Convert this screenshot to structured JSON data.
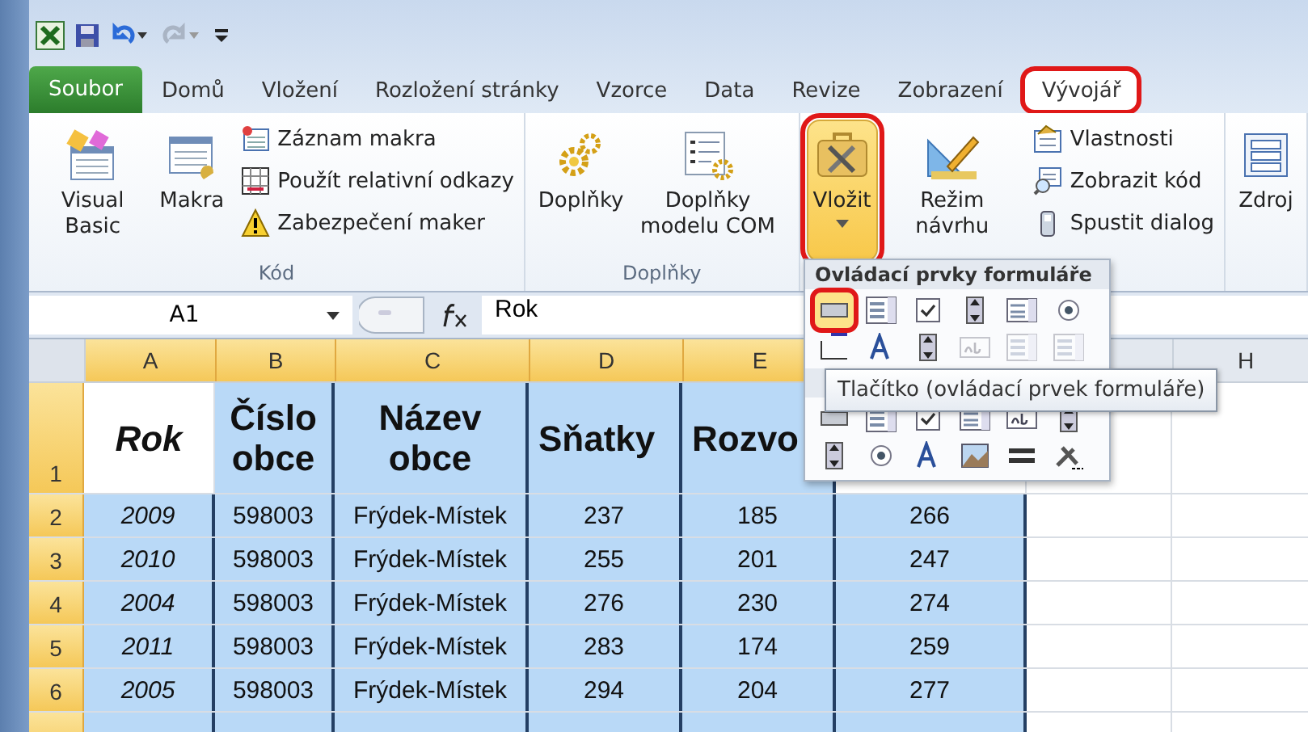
{
  "tabs": [
    {
      "label": "Soubor",
      "kind": "file",
      "selected": false,
      "highlighted": false
    },
    {
      "label": "Domů",
      "kind": "tab",
      "selected": false,
      "highlighted": false
    },
    {
      "label": "Vložení",
      "kind": "tab",
      "selected": false,
      "highlighted": false
    },
    {
      "label": "Rozložení stránky",
      "kind": "tab",
      "selected": false,
      "highlighted": false
    },
    {
      "label": "Vzorce",
      "kind": "tab",
      "selected": false,
      "highlighted": false
    },
    {
      "label": "Data",
      "kind": "tab",
      "selected": false,
      "highlighted": false
    },
    {
      "label": "Revize",
      "kind": "tab",
      "selected": false,
      "highlighted": false
    },
    {
      "label": "Zobrazení",
      "kind": "tab",
      "selected": false,
      "highlighted": false
    },
    {
      "label": "Vývojář",
      "kind": "tab",
      "selected": true,
      "highlighted": true
    }
  ],
  "ribbon": {
    "groups": [
      {
        "label": "Kód",
        "items": [
          {
            "label": "Visual Basic",
            "kind": "large"
          },
          {
            "label": "Makra",
            "kind": "large"
          },
          {
            "label": "Záznam makra",
            "kind": "small"
          },
          {
            "label": "Použít relativní odkazy",
            "kind": "small"
          },
          {
            "label": "Zabezpečení maker",
            "kind": "small"
          }
        ]
      },
      {
        "label": "Doplňky",
        "items": [
          {
            "label": "Doplňky",
            "kind": "large"
          },
          {
            "label": "Doplňky modelu COM",
            "kind": "large"
          }
        ]
      },
      {
        "items": [
          {
            "label": "Vložit",
            "kind": "large",
            "dropdown": true,
            "highlighted": true,
            "pressed": true
          },
          {
            "label": "Režim návrhu",
            "kind": "large"
          },
          {
            "label": "Vlastnosti",
            "kind": "small"
          },
          {
            "label": "Zobrazit kód",
            "kind": "small"
          },
          {
            "label": "Spustit dialog",
            "kind": "small"
          }
        ]
      },
      {
        "items": [
          {
            "label": "Zdroj",
            "kind": "large"
          }
        ]
      }
    ]
  },
  "formula_bar": {
    "name_box": "A1",
    "formula": "Rok"
  },
  "sheet": {
    "columns": [
      "A",
      "B",
      "C",
      "D",
      "E",
      "H"
    ],
    "rows": [
      {
        "number": "1",
        "cells": [
          {
            "text": "Rok",
            "selected": false
          },
          {
            "text": "Číslo obce",
            "selected": true
          },
          {
            "text": "Název obce",
            "selected": true
          },
          {
            "text": "Sňatky",
            "selected": true
          },
          {
            "text": "Rozvo",
            "selected": true
          }
        ]
      },
      {
        "number": "2",
        "cells": [
          {
            "text": "2009",
            "selected": true
          },
          {
            "text": "598003",
            "selected": true
          },
          {
            "text": "Frýdek-Místek",
            "selected": true
          },
          {
            "text": "237",
            "selected": true
          },
          {
            "text": "185",
            "selected": true
          },
          {
            "text": "266",
            "selected": true
          }
        ]
      },
      {
        "number": "3",
        "cells": [
          {
            "text": "2010",
            "selected": true
          },
          {
            "text": "598003",
            "selected": true
          },
          {
            "text": "Frýdek-Místek",
            "selected": true
          },
          {
            "text": "255",
            "selected": true
          },
          {
            "text": "201",
            "selected": true
          },
          {
            "text": "247",
            "selected": true
          }
        ]
      },
      {
        "number": "4",
        "cells": [
          {
            "text": "2004",
            "selected": true
          },
          {
            "text": "598003",
            "selected": true
          },
          {
            "text": "Frýdek-Místek",
            "selected": true
          },
          {
            "text": "276",
            "selected": true
          },
          {
            "text": "230",
            "selected": true
          },
          {
            "text": "274",
            "selected": true
          }
        ]
      },
      {
        "number": "5",
        "cells": [
          {
            "text": "2011",
            "selected": true
          },
          {
            "text": "598003",
            "selected": true
          },
          {
            "text": "Frýdek-Místek",
            "selected": true
          },
          {
            "text": "283",
            "selected": true
          },
          {
            "text": "174",
            "selected": true
          },
          {
            "text": "259",
            "selected": true
          }
        ]
      },
      {
        "number": "6",
        "cells": [
          {
            "text": "2005",
            "selected": true
          },
          {
            "text": "598003",
            "selected": true
          },
          {
            "text": "Frýdek-Místek",
            "selected": true
          },
          {
            "text": "294",
            "selected": true
          },
          {
            "text": "204",
            "selected": true
          },
          {
            "text": "277",
            "selected": true
          }
        ]
      }
    ]
  },
  "popup": {
    "title": "Ovládací prvky formuláře",
    "form_controls": [
      {
        "kind": "button",
        "selected": true,
        "disabled": false
      },
      {
        "kind": "combo",
        "selected": false,
        "disabled": false
      },
      {
        "kind": "checkbox",
        "selected": false,
        "disabled": false
      },
      {
        "kind": "spin",
        "selected": false,
        "disabled": false
      },
      {
        "kind": "listbox",
        "selected": false,
        "disabled": false
      },
      {
        "kind": "option",
        "selected": false,
        "disabled": false
      },
      {
        "kind": "group",
        "selected": false,
        "disabled": false
      },
      {
        "kind": "label",
        "selected": false,
        "disabled": false
      },
      {
        "kind": "scrollbar",
        "selected": false,
        "disabled": false
      },
      {
        "kind": "textbox",
        "selected": false,
        "disabled": true
      },
      {
        "kind": "combo",
        "selected": false,
        "disabled": true
      },
      {
        "kind": "combo",
        "selected": false,
        "disabled": true
      }
    ],
    "activex_controls": [
      {
        "kind": "button",
        "selected": false,
        "disabled": false
      },
      {
        "kind": "combo",
        "selected": false,
        "disabled": false
      },
      {
        "kind": "checkbox",
        "selected": false,
        "disabled": false
      },
      {
        "kind": "listbox",
        "selected": false,
        "disabled": false
      },
      {
        "kind": "textbox",
        "selected": false,
        "disabled": false
      },
      {
        "kind": "scrollbar",
        "selected": false,
        "disabled": false
      },
      {
        "kind": "spin",
        "selected": false,
        "disabled": false
      },
      {
        "kind": "option",
        "selected": false,
        "disabled": false
      },
      {
        "kind": "label",
        "selected": false,
        "disabled": false
      },
      {
        "kind": "image",
        "selected": false,
        "disabled": false
      },
      {
        "kind": "toggle",
        "selected": false,
        "disabled": false
      },
      {
        "kind": "tools",
        "selected": false,
        "disabled": false
      }
    ],
    "tooltip": "Tlačítko (ovládací prvek formuláře)"
  }
}
